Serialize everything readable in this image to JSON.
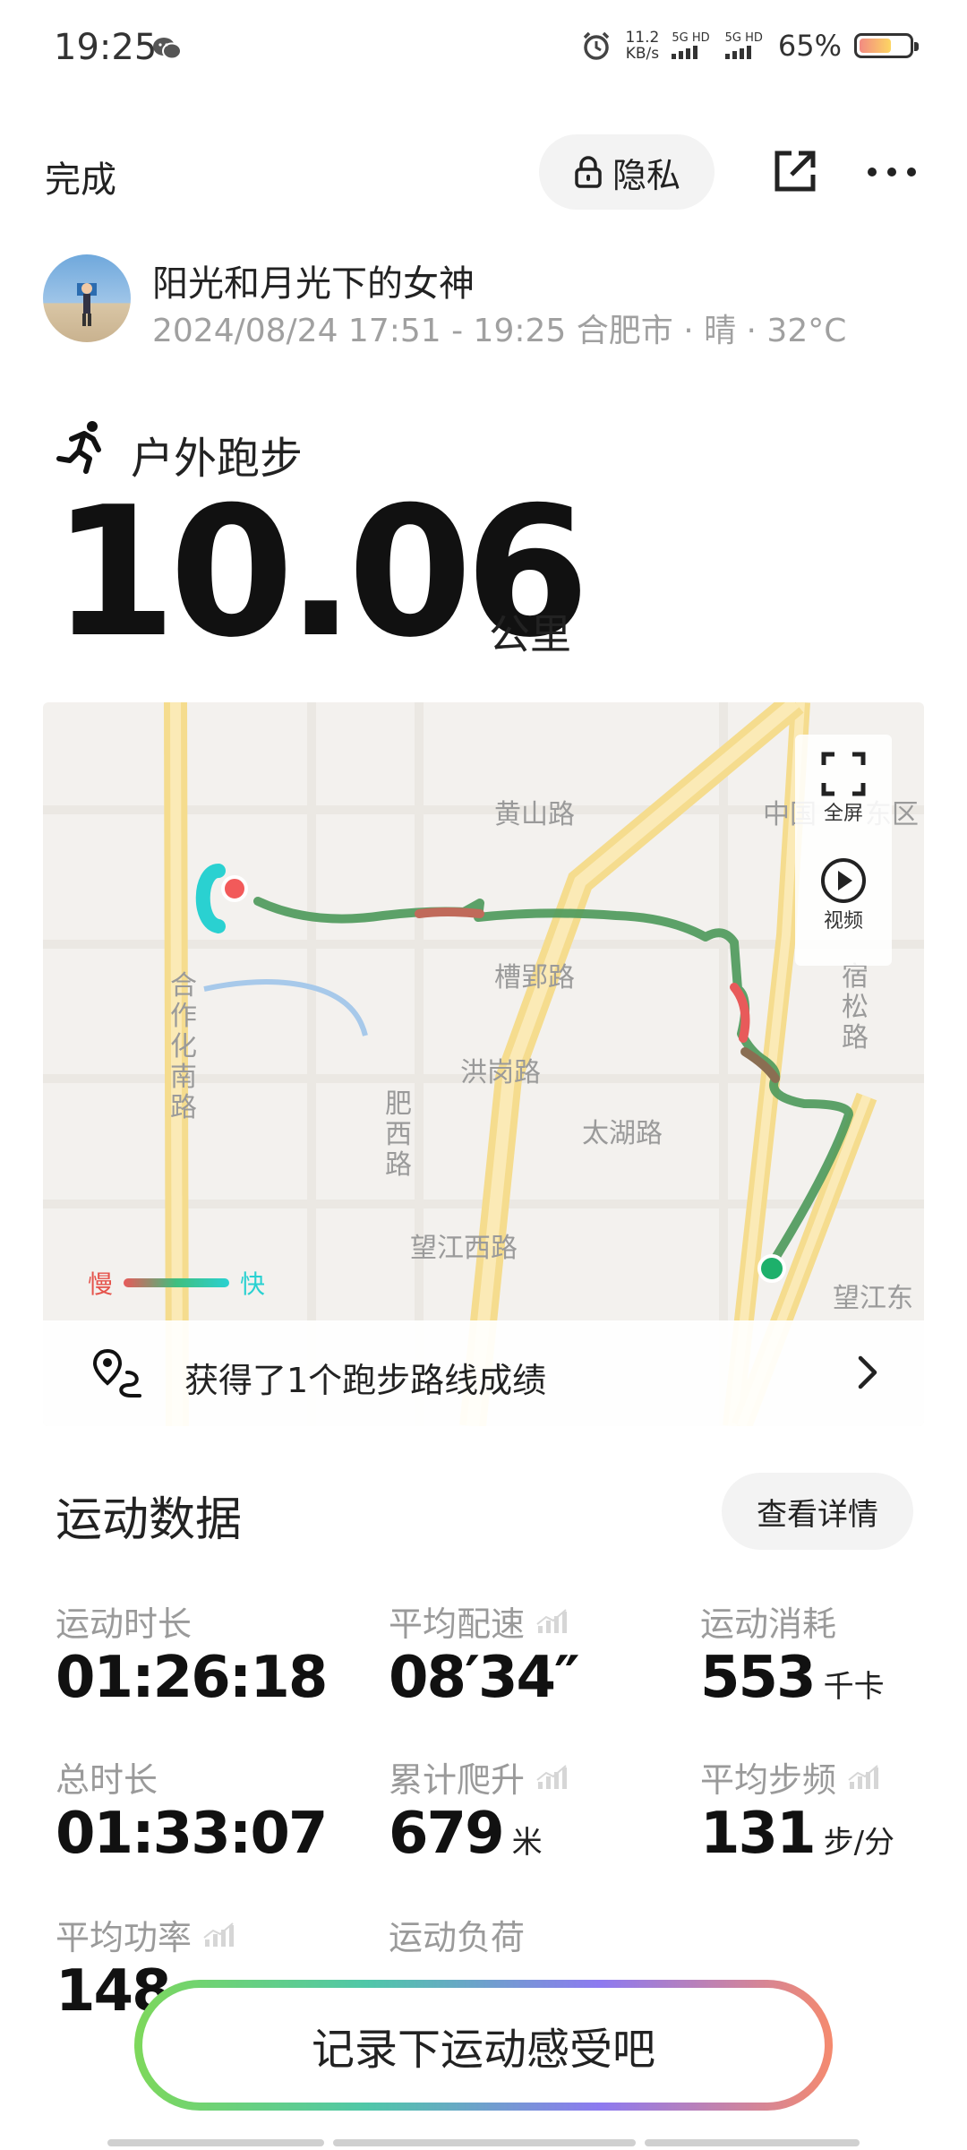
{
  "status_bar": {
    "time": "19:25",
    "net_speed_value": "11.2",
    "net_speed_unit": "KB/s",
    "sim1_label": "5G HD",
    "sim2_label": "5G HD",
    "battery_percent": "65%",
    "battery_level": 0.65,
    "icons": [
      "wechat-icon",
      "alarm-icon",
      "signal-icon",
      "battery-icon"
    ]
  },
  "header": {
    "done_label": "完成",
    "privacy_label": "隐私",
    "icons": [
      "lock-icon",
      "share-icon",
      "more-icon"
    ]
  },
  "user": {
    "name": "阳光和月光下的女神",
    "meta": "2024/08/24 17:51 - 19:25 合肥市 · 晴 · 32°C"
  },
  "activity": {
    "type": "户外跑步",
    "distance": "10.06",
    "distance_unit": "公里"
  },
  "map": {
    "labels": {
      "huangshan": "黄山路",
      "zhongguo": "中国",
      "dong": "东区",
      "caoying": "槽郢路",
      "hegang": "洪岗路",
      "taihu": "太湖路",
      "wangjiang_west": "望江西路",
      "wangjiang_east": "望江东",
      "hezuohua": "合作化南路",
      "feixi": "肥西路",
      "susong": "宿松路"
    },
    "fullscreen_label": "全屏",
    "video_label": "视频",
    "legend_slow": "慢",
    "legend_fast": "快",
    "route_achievement": "获得了1个跑步路线成绩",
    "route_colors": {
      "slow": "#e85a5a",
      "medium": "#4f9a5c",
      "fast": "#2ad1d1"
    }
  },
  "stats": {
    "section_title": "运动数据",
    "detail_button": "查看详情",
    "items": [
      {
        "label": "运动时长",
        "value": "01:26:18",
        "unit": "",
        "chart": false
      },
      {
        "label": "平均配速",
        "value": "08′34″",
        "unit": "",
        "chart": true
      },
      {
        "label": "运动消耗",
        "value": "553",
        "unit": "千卡",
        "chart": false
      },
      {
        "label": "总时长",
        "value": "01:33:07",
        "unit": "",
        "chart": false
      },
      {
        "label": "累计爬升",
        "value": "679",
        "unit": "米",
        "chart": true
      },
      {
        "label": "平均步频",
        "value": "131",
        "unit": "步/分",
        "chart": true
      },
      {
        "label": "平均功率",
        "value": "148",
        "unit": "",
        "chart": true
      },
      {
        "label": "运动负荷",
        "value": "",
        "unit": "",
        "chart": false
      }
    ]
  },
  "cta_label": "记录下运动感受吧"
}
